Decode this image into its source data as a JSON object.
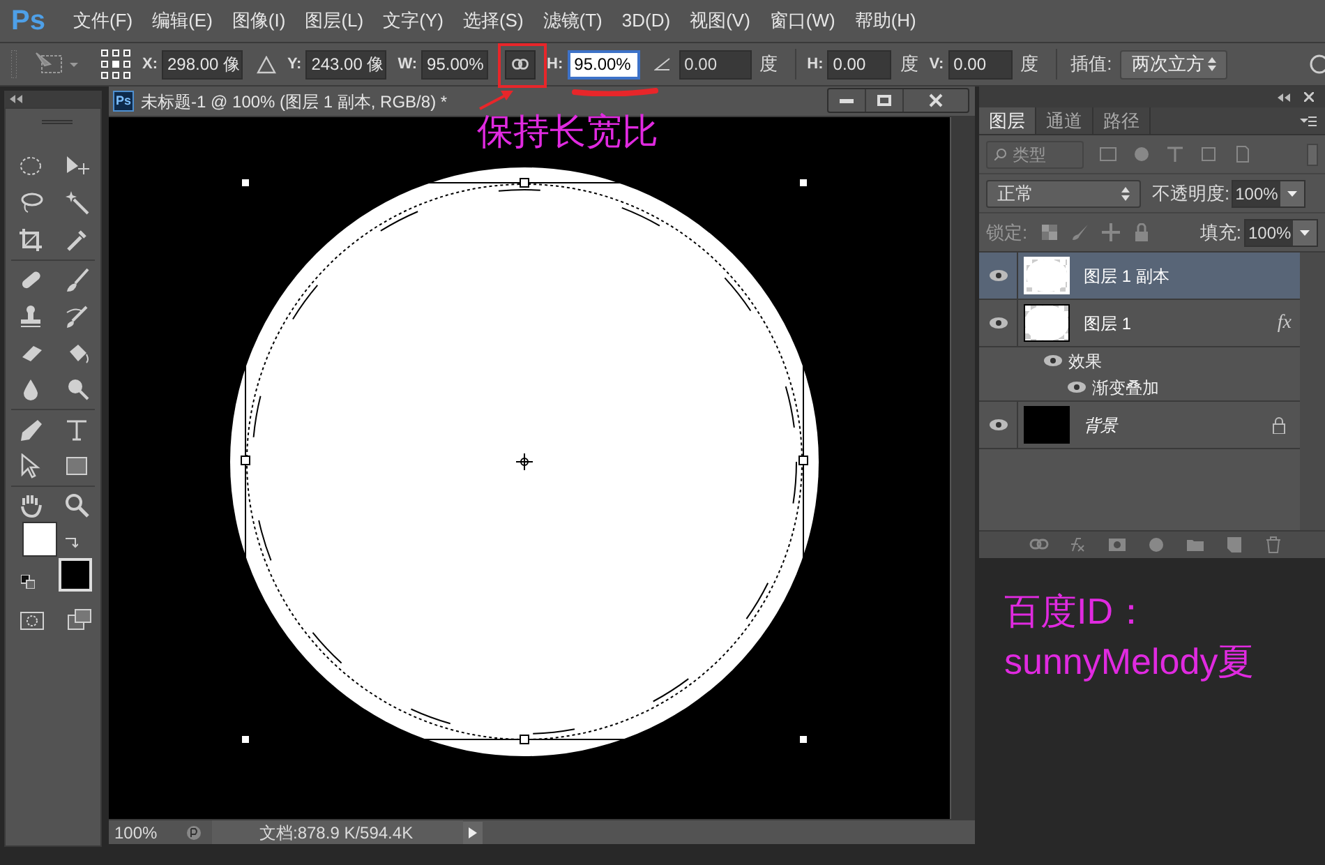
{
  "app_logo": "Ps",
  "menu": [
    "文件(F)",
    "编辑(E)",
    "图像(I)",
    "图层(L)",
    "文字(Y)",
    "选择(S)",
    "滤镜(T)",
    "3D(D)",
    "视图(V)",
    "窗口(W)",
    "帮助(H)"
  ],
  "options_bar": {
    "fields": [
      {
        "kind": "field",
        "label": "X:",
        "value": "298.00 像"
      },
      {
        "kind": "delta"
      },
      {
        "kind": "field",
        "label": "Y:",
        "value": "243.00 像"
      },
      {
        "kind": "field",
        "label": "W:",
        "value": "95.00%"
      },
      {
        "kind": "link",
        "on": true
      },
      {
        "kind": "field",
        "label": "H:",
        "value": "95.00%",
        "focused": true
      },
      {
        "kind": "angle",
        "value": "0.00",
        "unit": "度"
      },
      {
        "kind": "divider"
      },
      {
        "kind": "field",
        "label": "H:",
        "value": "0.00",
        "unit": "度"
      },
      {
        "kind": "field",
        "label": "V:",
        "value": "0.00",
        "unit": "度"
      },
      {
        "kind": "divider"
      },
      {
        "kind": "select",
        "label": "插值:",
        "value": "两次立方"
      }
    ]
  },
  "document": {
    "icon": "Ps",
    "title": "未标题-1 @ 100% (图层 1 副本, RGB/8) *",
    "zoom": "100%",
    "doc_info": "文档:878.9 K/594.4K"
  },
  "layers_panel": {
    "tabs": [
      {
        "label": "图层",
        "selected": true
      },
      {
        "label": "通道",
        "selected": false
      },
      {
        "label": "路径",
        "selected": false
      }
    ],
    "filter": "类型",
    "blend_mode": "正常",
    "opacity_label": "不透明度:",
    "opacity": "100%",
    "lock_label": "锁定:",
    "fill_label": "填充:",
    "fill": "100%",
    "layers": [
      {
        "kind": "layer",
        "name": "图层 1 副本",
        "visible": true,
        "selected": true,
        "locked": false
      },
      {
        "kind": "layer",
        "name": "图层 1",
        "visible": true,
        "selected": false,
        "fx": "fx",
        "locked": false,
        "children": [
          {
            "name": "效果",
            "visible": true,
            "children": [
              {
                "name": "渐变叠加",
                "visible": true
              }
            ]
          }
        ]
      },
      {
        "kind": "background",
        "name": "背景",
        "visible": true,
        "selected": false,
        "locked": true
      }
    ]
  },
  "annotations": {
    "callout": "保持长宽比",
    "author_lines": [
      "百度ID：",
      "sunnyMelody夏"
    ]
  }
}
